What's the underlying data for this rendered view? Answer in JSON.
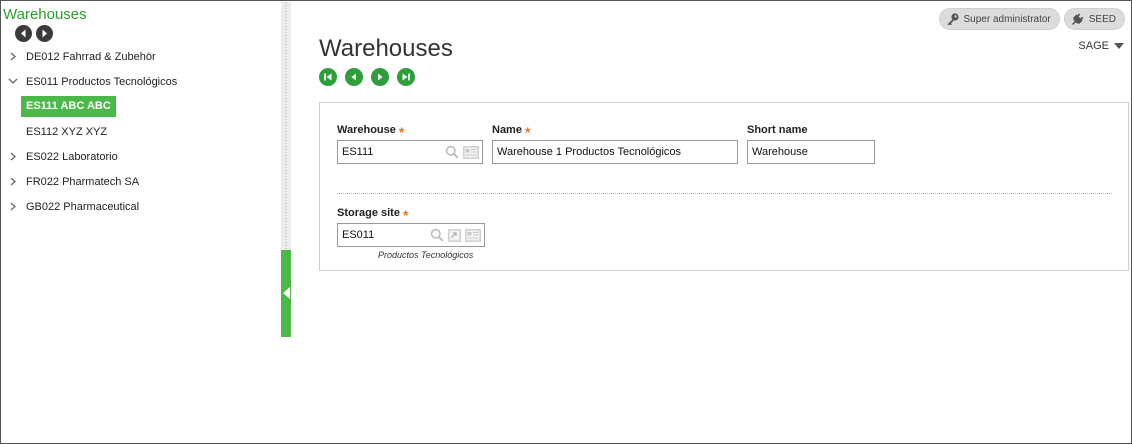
{
  "left_panel": {
    "title": "Warehouses",
    "tree": [
      {
        "label": "DE012 Fahrrad & Zubehör",
        "expanded": false
      },
      {
        "label": "ES011 Productos Tecnológicos",
        "expanded": true
      },
      {
        "label": "ES111 ABC ABC",
        "selected": true
      },
      {
        "label": "ES112 XYZ XYZ"
      },
      {
        "label": "ES022 Laboratorio",
        "expanded": false
      },
      {
        "label": "FR022 Pharmatech SA",
        "expanded": false
      },
      {
        "label": "GB022 Pharmaceutical",
        "expanded": false
      }
    ]
  },
  "header": {
    "user_label": "Super administrator",
    "folder_label": "SEED",
    "company_menu": "SAGE"
  },
  "main": {
    "title": "Warehouses",
    "fields": {
      "warehouse": {
        "label": "Warehouse",
        "value": "ES111",
        "required": true
      },
      "name": {
        "label": "Name",
        "value": "Warehouse 1 Productos Tecnológicos",
        "required": true
      },
      "short_name": {
        "label": "Short name",
        "value": "Warehouse"
      },
      "storage_site": {
        "label": "Storage site",
        "value": "ES011",
        "description": "Productos Tecnológicos",
        "required": true
      }
    },
    "required_mark": "*"
  },
  "colors": {
    "accent_green": "#4cb84a",
    "nav_green": "#2e9e3b",
    "required_orange": "#e8781c",
    "title_green": "#2aa02a"
  }
}
